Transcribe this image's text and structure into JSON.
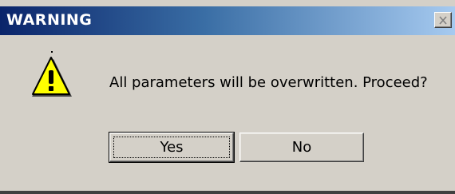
{
  "window": {
    "title": "WARNING",
    "close_icon": "close-icon"
  },
  "dialog": {
    "icon": "warning-icon",
    "message": "All parameters will be overwritten. Proceed?"
  },
  "buttons": {
    "yes_label": "Yes",
    "no_label": "No"
  },
  "colors": {
    "titlebar_start": "#0a246a",
    "titlebar_end": "#a6caf0",
    "face": "#d4d0c8",
    "warning_yellow": "#ffff00"
  }
}
